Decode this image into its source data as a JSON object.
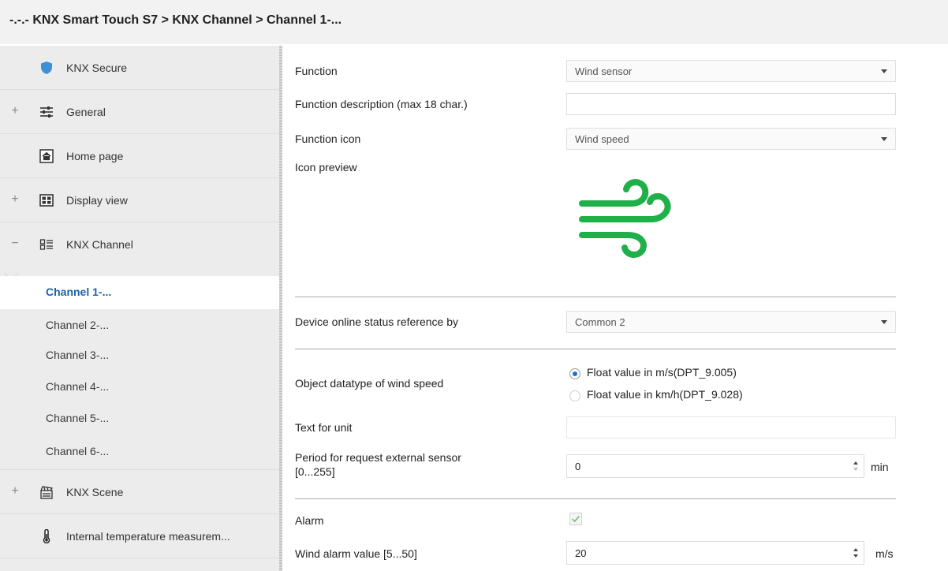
{
  "header": {
    "breadcrumb": "-.-.- KNX Smart Touch S7 > KNX Channel  > Channel 1-..."
  },
  "sidebar": {
    "items": [
      {
        "label": "KNX Secure",
        "expander": "",
        "icon": "shield-icon"
      },
      {
        "label": "General",
        "expander": "+",
        "icon": "sliders-icon"
      },
      {
        "label": "Home page",
        "expander": "",
        "icon": "home-icon"
      },
      {
        "label": "Display view",
        "expander": "+",
        "icon": "display-icon"
      },
      {
        "label": "KNX Channel",
        "expander": "−",
        "icon": "channel-icon"
      }
    ],
    "channels": [
      "Channel 1-...",
      "Channel 2-...",
      "Channel 3-...",
      "Channel 4-...",
      "Channel 5-...",
      "Channel 6-..."
    ],
    "items_after": [
      {
        "label": "KNX Scene",
        "expander": "+",
        "icon": "scene-icon"
      },
      {
        "label": "Internal temperature measurem...",
        "expander": "",
        "icon": "thermometer-icon"
      }
    ]
  },
  "form": {
    "function": {
      "label": "Function",
      "value": "Wind sensor"
    },
    "description": {
      "label": "Function description (max 18 char.)",
      "value": ""
    },
    "icon": {
      "label": "Function icon",
      "value": "Wind speed"
    },
    "preview": {
      "label": "Icon preview",
      "icon": "wind-icon",
      "color": "#1fb04a"
    },
    "online_status": {
      "label": "Device online status reference by",
      "value": "Common 2"
    },
    "datatype": {
      "label": "Object datatype of wind speed",
      "options": [
        "Float value in m/s(DPT_9.005)",
        "Float value in km/h(DPT_9.028)"
      ],
      "selected": 0
    },
    "unit_text": {
      "label": "Text for unit",
      "value": ""
    },
    "period": {
      "label_line1": "Period for request external sensor",
      "label_line2": "[0...255]",
      "value": "0",
      "unit": "min"
    },
    "alarm": {
      "label": "Alarm",
      "checked": true
    },
    "wind_alarm": {
      "label": "Wind alarm value [5...50]",
      "value": "20",
      "unit": "m/s"
    }
  },
  "colors": {
    "accent": "#1b63a6",
    "radio": "#1a73c9",
    "check": "#6abf6a"
  }
}
